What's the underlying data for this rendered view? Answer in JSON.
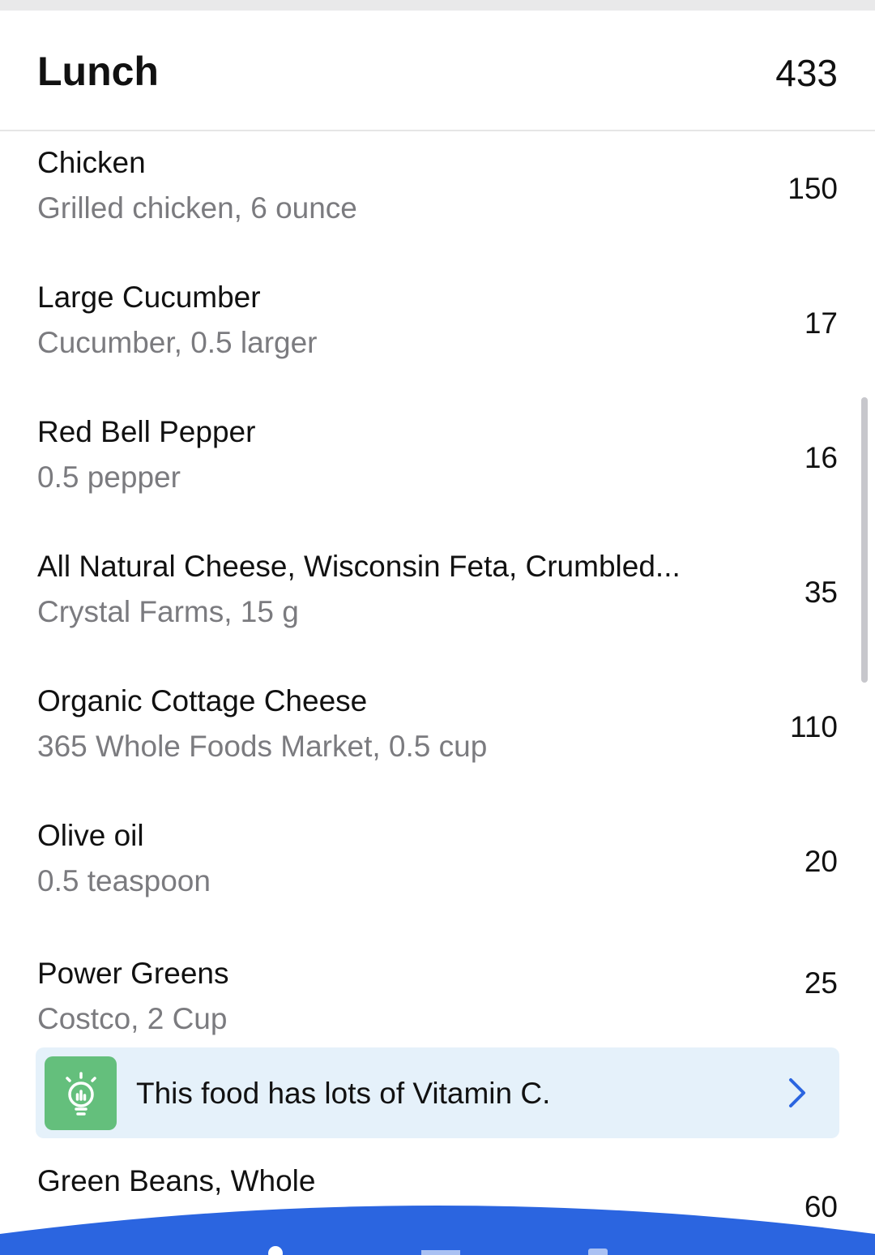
{
  "header": {
    "title": "Lunch",
    "total_calories": "433"
  },
  "foods": [
    {
      "name": "Chicken",
      "detail": "Grilled chicken, 6 ounce",
      "calories": "150"
    },
    {
      "name": "Large Cucumber",
      "detail": "Cucumber, 0.5 larger",
      "calories": "17"
    },
    {
      "name": "Red Bell Pepper",
      "detail": "0.5 pepper",
      "calories": "16"
    },
    {
      "name": "All Natural Cheese, Wisconsin Feta, Crumbled...",
      "detail": "Crystal Farms, 15 g",
      "calories": "35"
    },
    {
      "name": "Organic Cottage Cheese",
      "detail": "365 Whole Foods Market, 0.5 cup",
      "calories": "110"
    },
    {
      "name": "Olive oil",
      "detail": "0.5 teaspoon",
      "calories": "20"
    },
    {
      "name": "Power Greens",
      "detail": "Costco, 2 Cup",
      "calories": "25"
    },
    {
      "name": "Green Beans, Whole",
      "detail": "",
      "calories": "60"
    }
  ],
  "tip": {
    "text": "This food has lots of Vitamin C.",
    "icon": "lightbulb-icon"
  },
  "colors": {
    "accent": "#2b65e0",
    "tip_bg": "#e5f1fa",
    "tip_icon_bg": "#64bf7c",
    "secondary_text": "#7b7b7f"
  }
}
